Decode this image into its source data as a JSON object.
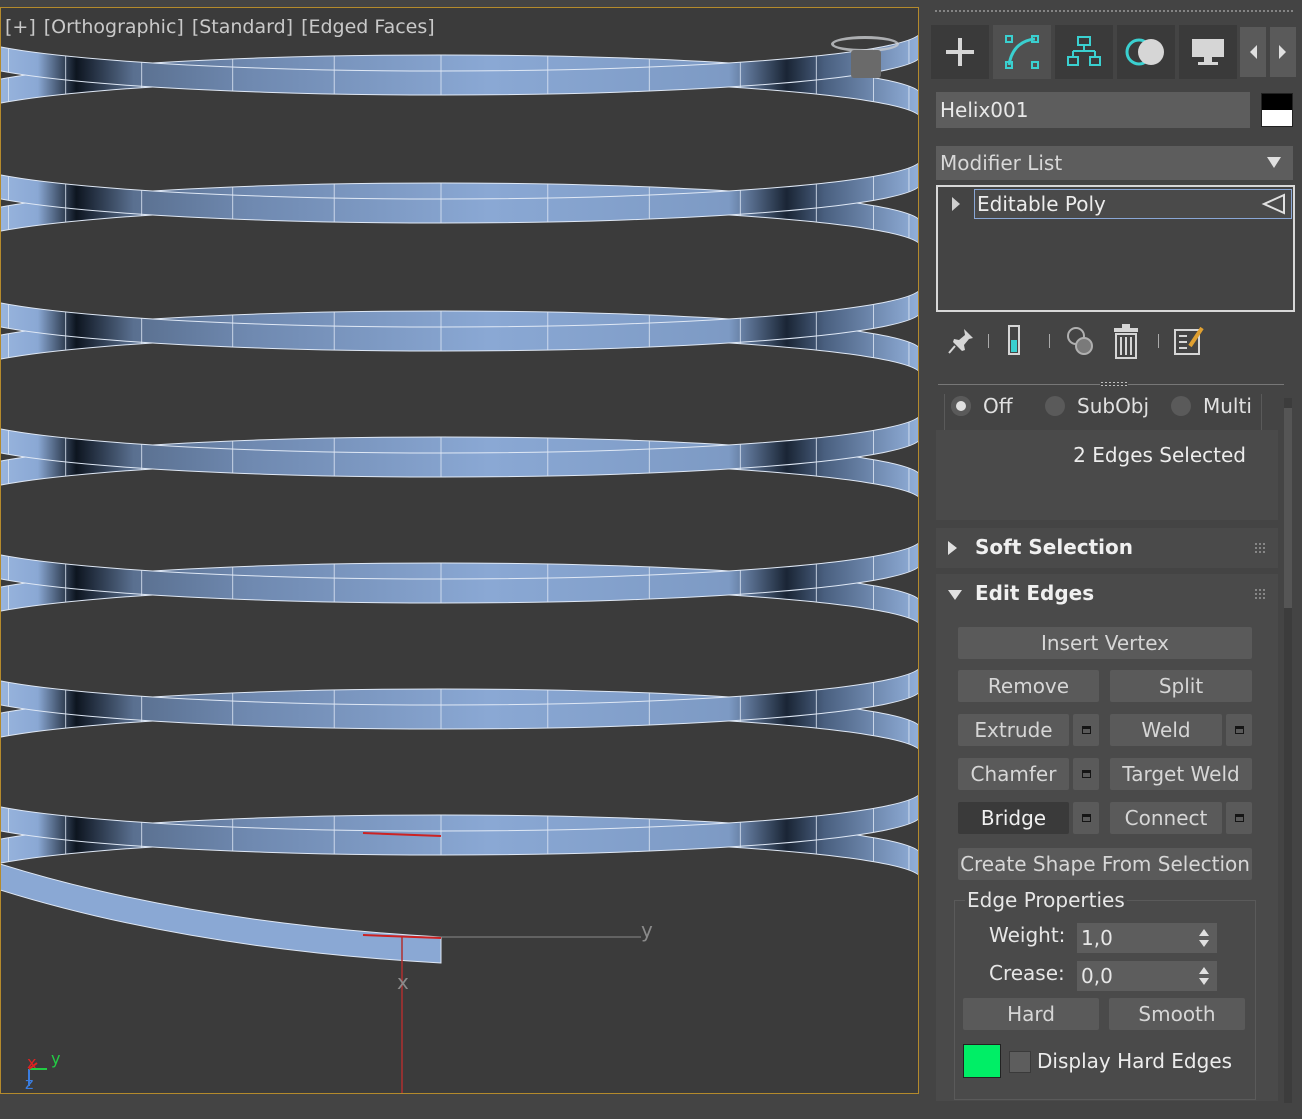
{
  "viewport": {
    "labels": [
      "[+]",
      "[Orthographic]",
      "[Standard]",
      "[Edged Faces]"
    ],
    "axis_y_label": "y",
    "axis_x_label": "x",
    "corner_axis_x": "x",
    "corner_axis_y": "y",
    "corner_axis_z": "z"
  },
  "tabs": [
    {
      "name": "create",
      "icon": "plus-icon"
    },
    {
      "name": "modify",
      "icon": "modify-curve-icon"
    },
    {
      "name": "hierarchy",
      "icon": "hierarchy-icon"
    },
    {
      "name": "motion",
      "icon": "motion-icon"
    },
    {
      "name": "display",
      "icon": "display-monitor-icon"
    }
  ],
  "object_name": "Helix001",
  "modifier_list_label": "Modifier List",
  "stack_item": "Editable Poly",
  "radio": {
    "off": "Off",
    "subobj": "SubObj",
    "multi": "Multi"
  },
  "selection_status": "2 Edges Selected",
  "rollouts": {
    "soft_selection": "Soft Selection",
    "edit_edges": "Edit Edges"
  },
  "buttons": {
    "insert_vertex": "Insert Vertex",
    "remove": "Remove",
    "split": "Split",
    "extrude": "Extrude",
    "weld": "Weld",
    "chamfer": "Chamfer",
    "target_weld": "Target Weld",
    "bridge": "Bridge",
    "connect": "Connect",
    "create_shape": "Create Shape From Selection",
    "hard": "Hard",
    "smooth": "Smooth"
  },
  "edge_properties": {
    "title": "Edge Properties",
    "weight_label": "Weight:",
    "weight_value": "1,0",
    "crease_label": "Crease:",
    "crease_value": "0,0"
  },
  "display_hard_edges_label": "Display Hard Edges",
  "colors": {
    "hard_edge_swatch": "#00ee66",
    "viewport_border": "#b48a2c",
    "helix_light": "#8aa8d4",
    "helix_dark": "#0d1520",
    "selected_edge": "#cc2222"
  }
}
